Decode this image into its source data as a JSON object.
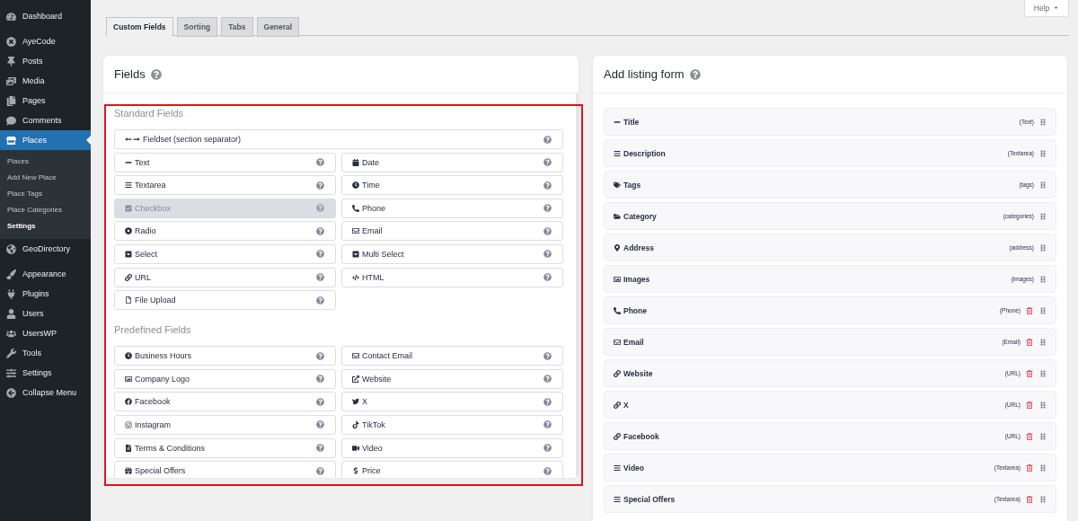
{
  "sidebar": {
    "groups": [
      [
        {
          "label": "Dashboard",
          "kind": "dashboard",
          "selected": false
        }
      ],
      [
        {
          "label": "AyeCode",
          "kind": "ayecode",
          "selected": false
        },
        {
          "label": "Posts",
          "kind": "posts",
          "selected": false
        },
        {
          "label": "Media",
          "kind": "media",
          "selected": false
        },
        {
          "label": "Pages",
          "kind": "pages",
          "selected": false
        },
        {
          "label": "Comments",
          "kind": "comments",
          "selected": false
        },
        {
          "label": "Places",
          "kind": "places",
          "selected": true,
          "children": [
            {
              "label": "Places",
              "selected": false
            },
            {
              "label": "Add New Place",
              "selected": false
            },
            {
              "label": "Place Tags",
              "selected": false
            },
            {
              "label": "Place Categories",
              "selected": false
            },
            {
              "label": "Settings",
              "selected": true
            }
          ]
        },
        {
          "label": "GeoDirectory",
          "kind": "geodirectory",
          "selected": false
        }
      ],
      [
        {
          "label": "Appearance",
          "kind": "appearance",
          "selected": false
        },
        {
          "label": "Plugins",
          "kind": "plugins",
          "selected": false
        },
        {
          "label": "Users",
          "kind": "users",
          "selected": false
        },
        {
          "label": "UsersWP",
          "kind": "userswp",
          "selected": false
        },
        {
          "label": "Tools",
          "kind": "tools",
          "selected": false
        },
        {
          "label": "Settings",
          "kind": "settings",
          "selected": false
        },
        {
          "label": "Collapse Menu",
          "kind": "collapse",
          "selected": false
        }
      ]
    ]
  },
  "help_button": {
    "label": "Help"
  },
  "tabs": [
    {
      "label": "Custom Fields",
      "selected": true
    },
    {
      "label": "Sorting",
      "selected": false
    },
    {
      "label": "Tabs",
      "selected": false
    },
    {
      "label": "General",
      "selected": false
    }
  ],
  "fields_panel": {
    "title": "Fields",
    "sections": [
      {
        "heading": "Standard Fields",
        "fields": [
          {
            "label": "Fieldset (section separator)",
            "kind": "fieldset",
            "disabled": false
          },
          {
            "label": "Text",
            "kind": "text",
            "disabled": false
          },
          {
            "label": "Date",
            "kind": "date",
            "disabled": false
          },
          {
            "label": "Textarea",
            "kind": "textarea",
            "disabled": false
          },
          {
            "label": "Time",
            "kind": "time",
            "disabled": false
          },
          {
            "label": "Checkbox",
            "kind": "checkbox",
            "disabled": true
          },
          {
            "label": "Phone",
            "kind": "phone",
            "disabled": false
          },
          {
            "label": "Radio",
            "kind": "radio",
            "disabled": false
          },
          {
            "label": "Email",
            "kind": "email",
            "disabled": false
          },
          {
            "label": "Select",
            "kind": "select",
            "disabled": false
          },
          {
            "label": "Multi Select",
            "kind": "select",
            "disabled": false
          },
          {
            "label": "URL",
            "kind": "url",
            "disabled": false
          },
          {
            "label": "HTML",
            "kind": "html",
            "disabled": false
          },
          {
            "label": "File Upload",
            "kind": "file",
            "disabled": false
          }
        ]
      },
      {
        "heading": "Predefined Fields",
        "fields": [
          {
            "label": "Business Hours",
            "kind": "time",
            "disabled": false
          },
          {
            "label": "Contact Email",
            "kind": "email",
            "disabled": false
          },
          {
            "label": "Company Logo",
            "kind": "image",
            "disabled": false
          },
          {
            "label": "Website",
            "kind": "external",
            "disabled": false
          },
          {
            "label": "Facebook",
            "kind": "facebook",
            "disabled": false
          },
          {
            "label": "X",
            "kind": "twitter",
            "disabled": false
          },
          {
            "label": "Instagram",
            "kind": "instagram",
            "disabled": false
          },
          {
            "label": "TikTok",
            "kind": "tiktok",
            "disabled": false
          },
          {
            "label": "Terms & Conditions",
            "kind": "document",
            "disabled": false
          },
          {
            "label": "Video",
            "kind": "video",
            "disabled": false
          },
          {
            "label": "Special Offers",
            "kind": "gift",
            "disabled": false
          },
          {
            "label": "Price",
            "kind": "price",
            "disabled": false
          }
        ]
      }
    ]
  },
  "form_panel": {
    "title": "Add listing form",
    "items": [
      {
        "label": "Title",
        "kind": "text",
        "type": "(Text)",
        "removable": false
      },
      {
        "label": "Description",
        "kind": "textarea",
        "type": "(Textarea)",
        "removable": false
      },
      {
        "label": "Tags",
        "kind": "tags",
        "type": "(tags)",
        "removable": false
      },
      {
        "label": "Category",
        "kind": "folder",
        "type": "(categories)",
        "removable": false
      },
      {
        "label": "Address",
        "kind": "address",
        "type": "(address)",
        "removable": false
      },
      {
        "label": "Images",
        "kind": "image",
        "type": "(images)",
        "removable": false
      },
      {
        "label": "Phone",
        "kind": "phone",
        "type": "(Phone)",
        "removable": true
      },
      {
        "label": "Email",
        "kind": "email",
        "type": "(Email)",
        "removable": true
      },
      {
        "label": "Website",
        "kind": "url",
        "type": "(URL)",
        "removable": true
      },
      {
        "label": "X",
        "kind": "url",
        "type": "(URL)",
        "removable": true
      },
      {
        "label": "Facebook",
        "kind": "url",
        "type": "(URL)",
        "removable": true
      },
      {
        "label": "Video",
        "kind": "textarea",
        "type": "(Textarea)",
        "removable": true
      },
      {
        "label": "Special Offers",
        "kind": "textarea",
        "type": "(Textarea)",
        "removable": true
      }
    ]
  }
}
